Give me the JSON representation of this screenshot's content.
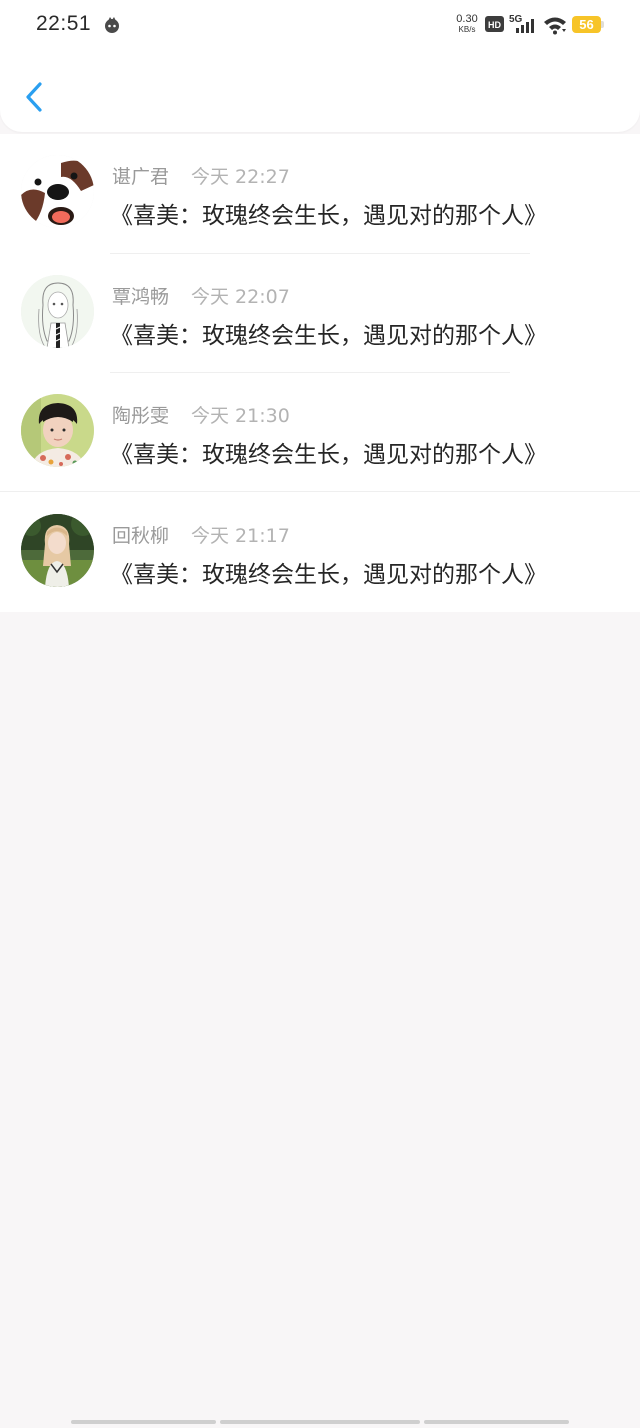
{
  "status_bar": {
    "time": "22:51",
    "net_speed_value": "0.30",
    "net_speed_unit": "KB/s",
    "hd_label": "HD",
    "network_label": "5G",
    "battery_level": "56",
    "battery_color": "#f7c428"
  },
  "header": {
    "back_icon": "chevron-left-icon",
    "accent_color": "#2a9ff0"
  },
  "notifications": [
    {
      "name": "谌广君",
      "time": "今天 22:27",
      "message": "《喜美：玫瑰终会生长，遇见对的那个人》",
      "avatar": "dog-cartoon-avatar"
    },
    {
      "name": "覃鸿畅",
      "time": "今天 22:07",
      "message": "《喜美：玫瑰终会生长，遇见对的那个人》",
      "avatar": "sketch-girl-avatar"
    },
    {
      "name": "陶彤雯",
      "time": "今天 21:30",
      "message": "《喜美：玫瑰终会生长，遇见对的那个人》",
      "avatar": "boy-photo-avatar"
    },
    {
      "name": "回秋柳",
      "time": "今天 21:17",
      "message": "《喜美：玫瑰终会生长，遇见对的那个人》",
      "avatar": "girl-outdoor-avatar"
    }
  ]
}
